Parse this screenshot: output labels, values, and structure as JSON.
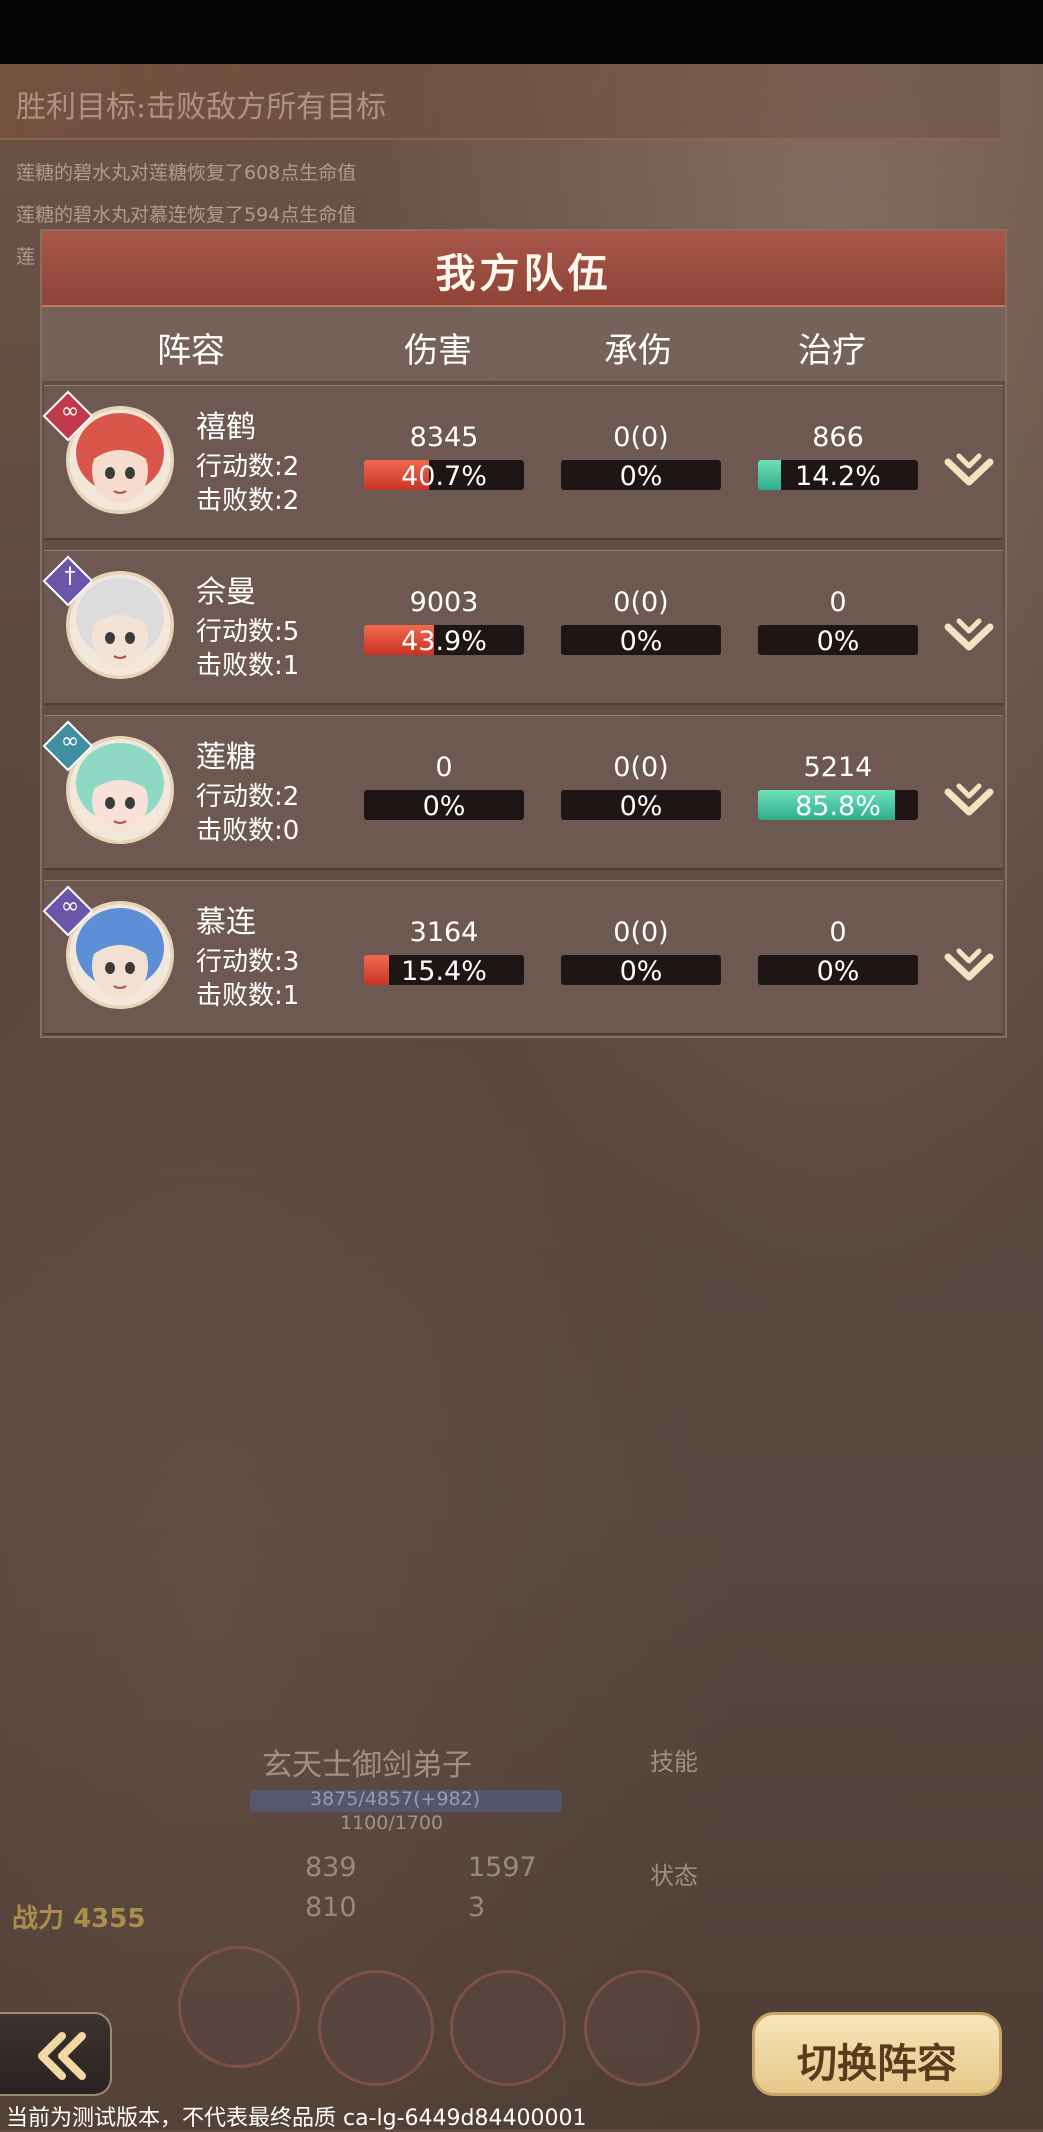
{
  "header": {
    "victory_goal": "胜利目标:击败敌方所有目标",
    "log": [
      "莲糖的碧水丸对莲糖恢复了608点生命值",
      "莲糖的碧水丸对慕连恢复了594点生命值",
      "莲"
    ]
  },
  "panel": {
    "title": "我方队伍",
    "columns": [
      "阵容",
      "伤害",
      "承伤",
      "治疗"
    ],
    "members": [
      {
        "name": "禧鹤",
        "actions": "行动数:2",
        "kills": "击败数:2",
        "badge_icon": "gourd-icon",
        "badge_color": "#c0394a",
        "damage": "8345",
        "damage_pct": "40.7%",
        "damage_frac": 0.407,
        "taken": "0(0)",
        "taken_pct": "0%",
        "taken_frac": 0,
        "heal": "866",
        "heal_pct": "14.2%",
        "heal_frac": 0.142
      },
      {
        "name": "佘曼",
        "actions": "行动数:5",
        "kills": "击败数:1",
        "badge_icon": "sword-icon",
        "badge_color": "#6b55a8",
        "damage": "9003",
        "damage_pct": "43.9%",
        "damage_frac": 0.439,
        "taken": "0(0)",
        "taken_pct": "0%",
        "taken_frac": 0,
        "heal": "0",
        "heal_pct": "0%",
        "heal_frac": 0
      },
      {
        "name": "莲糖",
        "actions": "行动数:2",
        "kills": "击败数:0",
        "badge_icon": "gourd-icon",
        "badge_color": "#3f8fa0",
        "damage": "0",
        "damage_pct": "0%",
        "damage_frac": 0,
        "taken": "0(0)",
        "taken_pct": "0%",
        "taken_frac": 0,
        "heal": "5214",
        "heal_pct": "85.8%",
        "heal_frac": 0.858
      },
      {
        "name": "慕连",
        "actions": "行动数:3",
        "kills": "击败数:1",
        "badge_icon": "gourd-icon",
        "badge_color": "#6b55a8",
        "damage": "3164",
        "damage_pct": "15.4%",
        "damage_frac": 0.154,
        "taken": "0(0)",
        "taken_pct": "0%",
        "taken_frac": 0,
        "heal": "0",
        "heal_pct": "0%",
        "heal_frac": 0
      }
    ]
  },
  "background_unit": {
    "name": "玄天士御剑弟子",
    "hp": "3875/4857(+982)",
    "shield": "1100/1700",
    "atk": "839",
    "def": "1597",
    "speed": "810",
    "extra": "3",
    "power_label": "战力",
    "power_value": "4355",
    "skills_label": "技能",
    "status_label": "状态"
  },
  "buttons": {
    "back_icon": "back-arrow-icon",
    "switch_label": "切换阵容"
  },
  "footer": {
    "notice": "当前为测试版本，不代表最终品质  ca-lg-6449d84400001"
  },
  "colors": {
    "damage_bar": "#e04a32",
    "heal_bar": "#3fbfa0",
    "header_red": "#a8574a"
  }
}
